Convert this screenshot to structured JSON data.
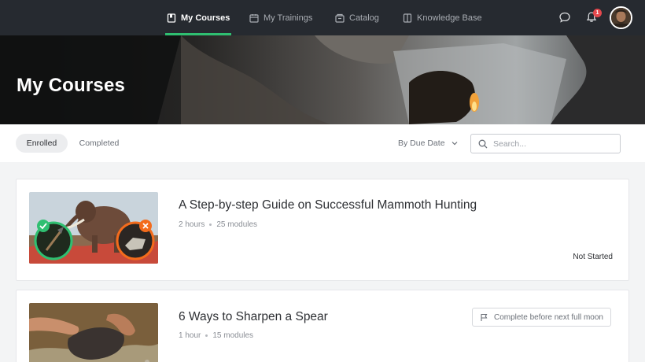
{
  "nav": {
    "items": [
      {
        "label": "My Courses",
        "icon": "book-icon",
        "active": true
      },
      {
        "label": "My Trainings",
        "icon": "calendar-icon",
        "active": false
      },
      {
        "label": "Catalog",
        "icon": "catalog-icon",
        "active": false
      },
      {
        "label": "Knowledge Base",
        "icon": "knowledge-base-icon",
        "active": false
      }
    ],
    "notification_count": "1"
  },
  "hero": {
    "title": "My Courses"
  },
  "filters": {
    "tabs": [
      {
        "label": "Enrolled",
        "active": true
      },
      {
        "label": "Completed",
        "active": false
      }
    ],
    "sort_label": "By Due Date",
    "search_placeholder": "Search..."
  },
  "courses": [
    {
      "title": "A Step-by-step Guide on Successful Mammoth Hunting",
      "duration": "2 hours",
      "modules": "25 modules",
      "status": "Not Started"
    },
    {
      "title": "6 Ways to Sharpen a Spear",
      "duration": "1 hour",
      "modules": "15 modules",
      "due_tag": "Complete before next full moon"
    }
  ],
  "colors": {
    "accent": "#2fbf71",
    "nav_bg": "#262a30",
    "badge": "#e5484d"
  }
}
